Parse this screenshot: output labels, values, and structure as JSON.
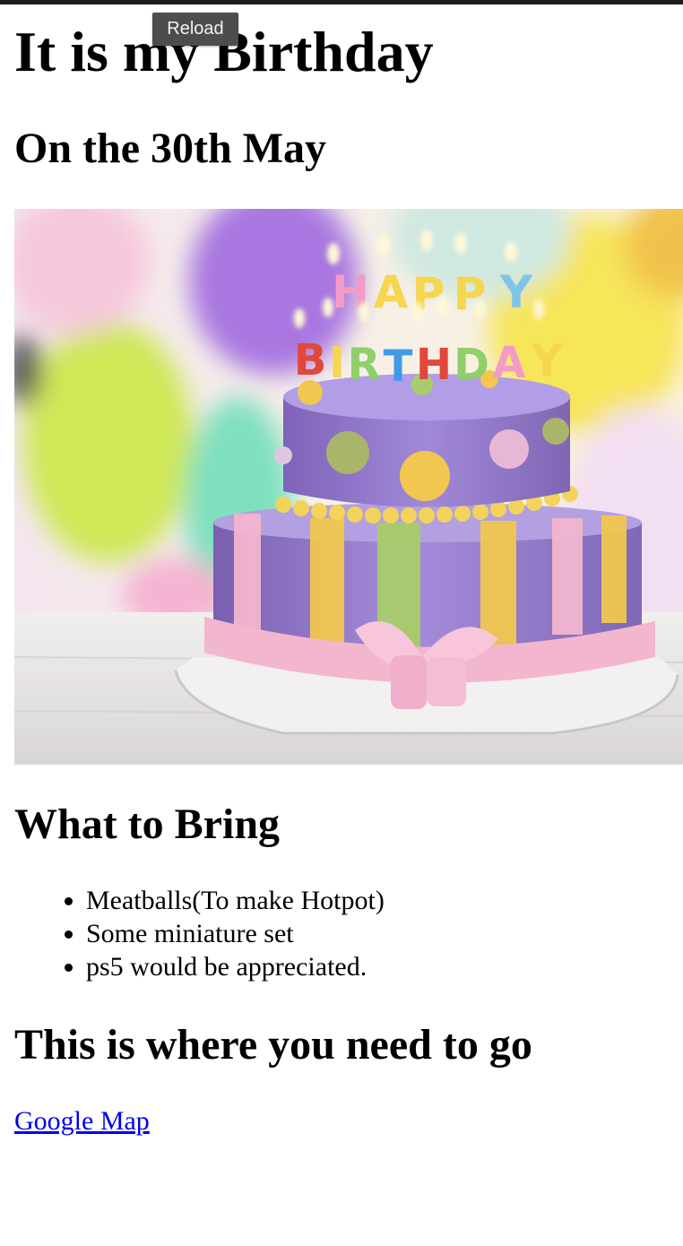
{
  "tooltip": {
    "label": "Reload"
  },
  "page": {
    "title": "It is my Birthday",
    "date_heading": "On the 30th May",
    "image": {
      "subject": "birthday-cake",
      "candle_text_top": "HAPPY",
      "candle_text_bottom": "BIRTHDAY"
    },
    "bring": {
      "heading": "What to Bring",
      "items": [
        "Meatballs(To make Hotpot)",
        "Some miniature set",
        "ps5 would be appreciated."
      ]
    },
    "directions": {
      "heading": "This is where you need to go",
      "link_label": "Google Map"
    }
  },
  "colors": {
    "link": "#0000ee",
    "cake_purple": "#8e74c8",
    "ribbon_pink": "#f3b6cf",
    "stripe_yellow": "#f1c74f",
    "stripe_green": "#a8cd6a"
  }
}
